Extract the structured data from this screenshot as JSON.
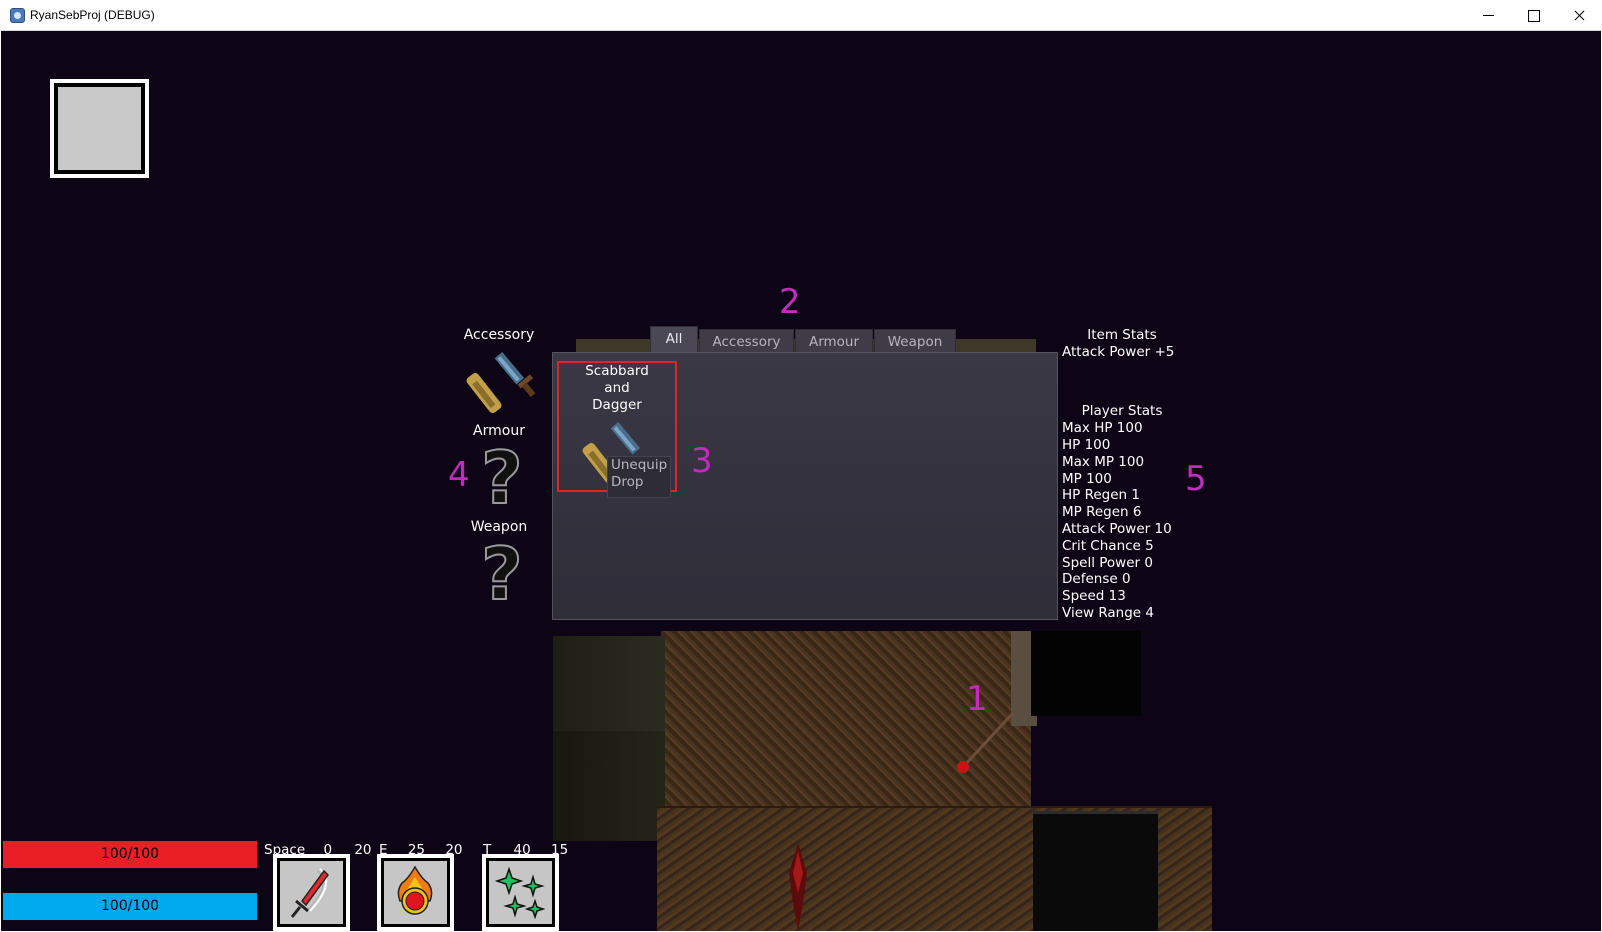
{
  "window": {
    "title": "RyanSebProj (DEBUG)",
    "icon": "godot-app-icon"
  },
  "equipment": {
    "accessory_label": "Accessory",
    "armour_label": "Armour",
    "weapon_label": "Weapon"
  },
  "inventory": {
    "tabs": [
      "All",
      "Accessory",
      "Armour",
      "Weapon"
    ],
    "active_tab": "All",
    "item": {
      "name_lines": [
        "Scabbard",
        "and",
        "Dagger"
      ]
    },
    "context_menu": [
      "Unequip",
      "Drop"
    ]
  },
  "item_stats": {
    "title": "Item Stats",
    "lines": [
      "Attack Power +5"
    ]
  },
  "player_stats": {
    "title": "Player Stats",
    "lines": [
      "Max HP 100",
      "HP 100",
      "Max MP 100",
      "MP 100",
      "HP Regen 1",
      "MP Regen 6",
      "Attack Power 10",
      "Crit Chance 5",
      "Spell Power 0",
      "Defense 0",
      "Speed 13",
      "View Range 4"
    ]
  },
  "annotations": [
    "1",
    "2",
    "3",
    "4",
    "5"
  ],
  "bars": {
    "hp_text": "100/100",
    "mp_text": "100/100",
    "hp_color": "#ea1f26",
    "mp_color": "#00a8ee"
  },
  "skills": [
    {
      "key": "Space",
      "cost": "0",
      "cooldown": "20",
      "icon": "sword-slash-icon"
    },
    {
      "key": "E",
      "cost": "25",
      "cooldown": "20",
      "icon": "fireball-icon"
    },
    {
      "key": "T",
      "cost": "40",
      "cooldown": "15",
      "icon": "sparkles-icon"
    }
  ],
  "colors": {
    "annotation": "#c02cbd",
    "selection_border": "#e0242b",
    "background": "#0d0416"
  }
}
